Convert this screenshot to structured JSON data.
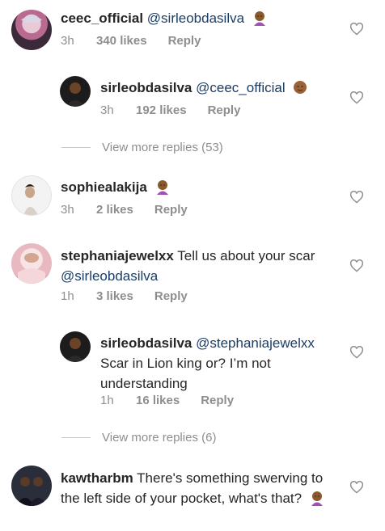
{
  "comments": [
    {
      "username": "ceec_official",
      "mention": "@sirleobdasilva",
      "text": "",
      "time": "3h",
      "likes": "340 likes",
      "reply_label": "Reply"
    },
    {
      "username": "sirleobdasilva",
      "mention": "@ceec_official",
      "text": "",
      "time": "3h",
      "likes": "192 likes",
      "reply_label": "Reply"
    },
    {
      "username": "sophiealakija",
      "mention": "",
      "text": "",
      "time": "3h",
      "likes": "2 likes",
      "reply_label": "Reply"
    },
    {
      "username": "stephaniajewelxx",
      "text": "Tell us about your scar",
      "mention": "@sirleobdasilva",
      "time": "1h",
      "likes": "3 likes",
      "reply_label": "Reply"
    },
    {
      "username": "sirleobdasilva",
      "mention": "@stephaniajewelxx",
      "text": "Scar in Lion king or? I’m not understanding",
      "time": "1h",
      "likes": "16 likes",
      "reply_label": "Reply"
    },
    {
      "username": "kawtharbm",
      "text": "There's something swerving to the left side of your pocket, what's that?",
      "mention": "",
      "time": "",
      "likes": "",
      "reply_label": ""
    }
  ],
  "view_more_1": "View more replies (53)",
  "view_more_2": "View more replies (6)",
  "icons": {
    "like": "heart-outline-icon",
    "emoji_shrug": "woman-shrugging-emoji",
    "emoji_baby": "baby-face-emoji"
  },
  "colors": {
    "mention": "#1a3d66",
    "meta": "#8e8e8e",
    "text": "#262626"
  }
}
